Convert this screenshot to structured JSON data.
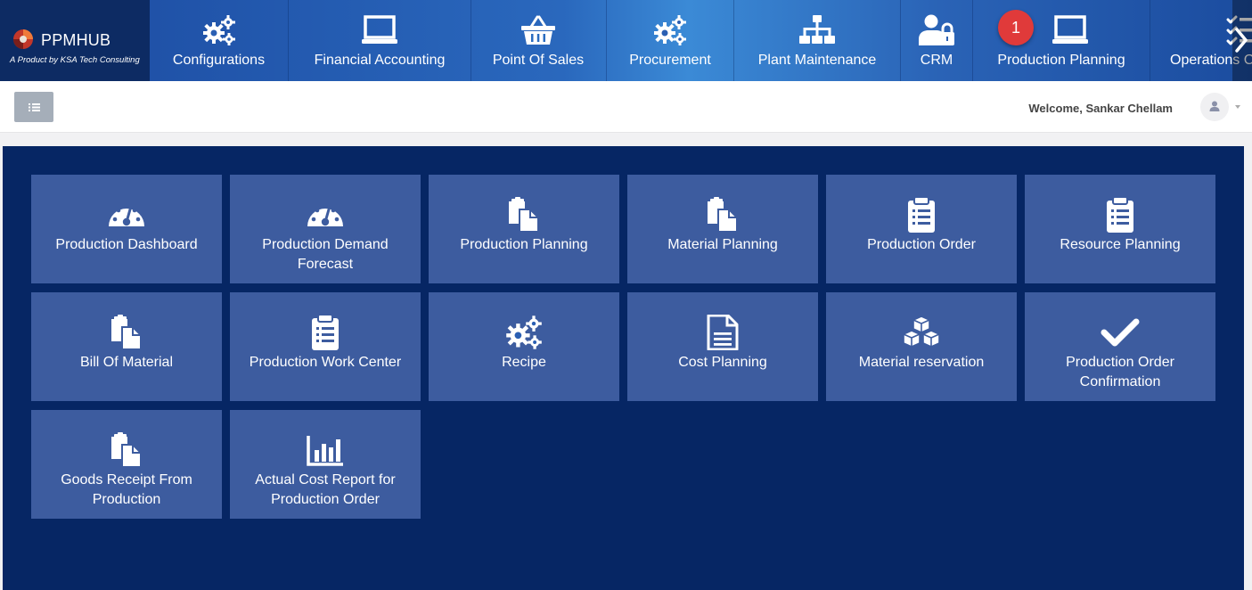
{
  "brand": {
    "name": "PPMHUB",
    "tagline": "A Product by KSA Tech Consulting"
  },
  "modules": [
    {
      "label": "Configurations",
      "icon": "gears-icon"
    },
    {
      "label": "Financial Accounting",
      "icon": "laptop-icon"
    },
    {
      "label": "Point Of Sales",
      "icon": "basket-icon"
    },
    {
      "label": "Procurement",
      "icon": "gears-icon"
    },
    {
      "label": "Plant Maintenance",
      "icon": "sitemap-icon"
    },
    {
      "label": "CRM",
      "icon": "user-lock-icon"
    },
    {
      "label": "Production Planning",
      "icon": "laptop-icon"
    },
    {
      "label": "Operations C",
      "icon": "tasks-icon"
    }
  ],
  "notification_badge": "1",
  "header": {
    "welcome": "Welcome, Sankar Chellam"
  },
  "tiles": [
    {
      "label": "Production Dashboard",
      "icon": "dashboard-icon"
    },
    {
      "label": "Production Demand Forecast",
      "icon": "dashboard-icon"
    },
    {
      "label": "Production Planning",
      "icon": "copy-icon"
    },
    {
      "label": "Material Planning",
      "icon": "copy-icon"
    },
    {
      "label": "Production Order",
      "icon": "clipboard-icon"
    },
    {
      "label": "Resource Planning",
      "icon": "clipboard-icon"
    },
    {
      "label": "Bill Of Material",
      "icon": "copy-icon"
    },
    {
      "label": "Production Work Center",
      "icon": "clipboard-icon"
    },
    {
      "label": "Recipe",
      "icon": "gears-icon"
    },
    {
      "label": "Cost Planning",
      "icon": "file-icon"
    },
    {
      "label": "Material reservation",
      "icon": "cubes-icon"
    },
    {
      "label": "Production Order Confirmation",
      "icon": "check-icon"
    },
    {
      "label": "Goods Receipt From Production",
      "icon": "copy-icon"
    },
    {
      "label": "Actual Cost Report for Production Order",
      "icon": "bar-chart-icon"
    }
  ],
  "colors": {
    "brand_bg": "#0d2b63",
    "panel_bg": "#062664",
    "tile_bg": "#3d5c9f",
    "badge": "#e03a3a"
  }
}
